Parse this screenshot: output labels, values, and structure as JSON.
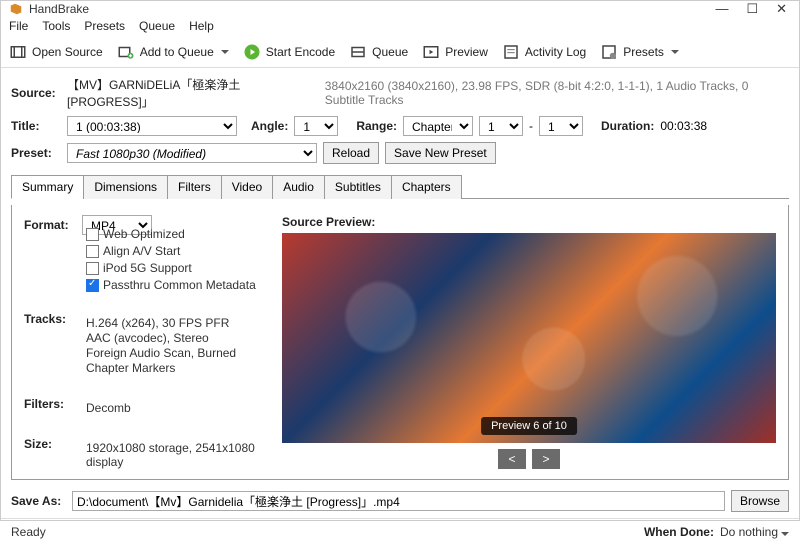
{
  "window": {
    "title": "HandBrake"
  },
  "menu": {
    "file": "File",
    "tools": "Tools",
    "presets": "Presets",
    "queue": "Queue",
    "help": "Help"
  },
  "toolbar": {
    "open_source": "Open Source",
    "add_to_queue": "Add to Queue",
    "start_encode": "Start Encode",
    "queue": "Queue",
    "preview": "Preview",
    "activity_log": "Activity Log",
    "presets": "Presets"
  },
  "source": {
    "label": "Source:",
    "name": "【MV】GARNiDELiA「極楽浄土 [PROGRESS]」",
    "info": "3840x2160 (3840x2160), 23.98 FPS, SDR (8-bit 4:2:0, 1-1-1), 1 Audio Tracks, 0 Subtitle Tracks"
  },
  "title_row": {
    "title_label": "Title:",
    "title_value": "1  (00:03:38)",
    "angle_label": "Angle:",
    "angle_value": "1",
    "range_label": "Range:",
    "range_type": "Chapters",
    "range_from": "1",
    "range_sep": "-",
    "range_to": "1",
    "duration_label": "Duration:",
    "duration_value": "00:03:38"
  },
  "preset_row": {
    "label": "Preset:",
    "value": "Fast 1080p30  (Modified)",
    "reload": "Reload",
    "save_new": "Save New Preset"
  },
  "tabs": {
    "summary": "Summary",
    "dimensions": "Dimensions",
    "filters": "Filters",
    "video": "Video",
    "audio": "Audio",
    "subtitles": "Subtitles",
    "chapters": "Chapters"
  },
  "summary": {
    "format_label": "Format:",
    "format_value": "MP4",
    "cb_web": "Web Optimized",
    "cb_align": "Align A/V Start",
    "cb_ipod": "iPod 5G Support",
    "cb_passthru": "Passthru Common Metadata",
    "tracks_label": "Tracks:",
    "track_line1": "H.264 (x264), 30 FPS PFR",
    "track_line2": "AAC (avcodec), Stereo",
    "track_line3": "Foreign Audio Scan, Burned",
    "track_line4": "Chapter Markers",
    "filters_label": "Filters:",
    "filters_value": "Decomb",
    "size_label": "Size:",
    "size_value": "1920x1080 storage, 2541x1080 display",
    "preview_label": "Source Preview:",
    "preview_caption": "Preview 6 of 10",
    "prev": "<",
    "next": ">"
  },
  "saveas": {
    "label": "Save As:",
    "value": "D:\\document\\【Mv】Garnidelia「極楽浄土 [Progress]」.mp4",
    "browse": "Browse"
  },
  "status": {
    "ready": "Ready",
    "when_done_label": "When Done:",
    "when_done_value": "Do nothing"
  }
}
